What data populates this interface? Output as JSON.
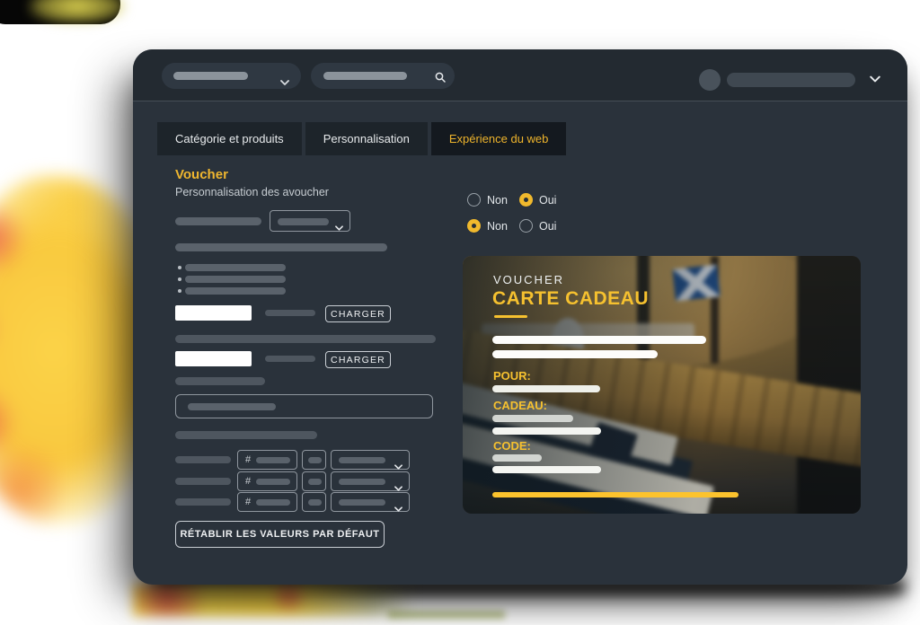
{
  "window": {
    "topbar": {
      "icons": [
        "chevron-down-icon",
        "search-icon",
        "avatar",
        "chevron-down-icon"
      ]
    },
    "tabs": [
      {
        "label": "Catégorie et produits",
        "active": false
      },
      {
        "label": "Personnalisation",
        "active": false
      },
      {
        "label": "Expérience du web",
        "active": true
      }
    ],
    "panel": {
      "title": "Voucher",
      "subtitle": "Personnalisation des avoucher",
      "charger_button": "CHARGER",
      "hash_prefix": "#",
      "reset_button": "RÉTABLIR LES VALEURS PAR DÉFAUT"
    },
    "radio_rows": [
      {
        "options": [
          {
            "label": "Non",
            "selected": false
          },
          {
            "label": "Oui",
            "selected": true
          }
        ]
      },
      {
        "options": [
          {
            "label": "Non",
            "selected": true
          },
          {
            "label": "Oui",
            "selected": false
          }
        ]
      }
    ],
    "voucher_card": {
      "kicker": "VOUCHER",
      "title": "CARTE CADEAU",
      "fields": [
        {
          "label": "POUR:"
        },
        {
          "label": "CADEAU:"
        },
        {
          "label": "CODE:"
        }
      ]
    },
    "colors": {
      "accent_yellow": "#efb62f",
      "card_yellow": "#fcc32d",
      "window_bg": "#2a323b",
      "topbar_bg": "#232a31",
      "tab_bg": "#1d242a",
      "tab_active_bg": "#14191f",
      "blob_yellow": "#fbd348"
    }
  }
}
